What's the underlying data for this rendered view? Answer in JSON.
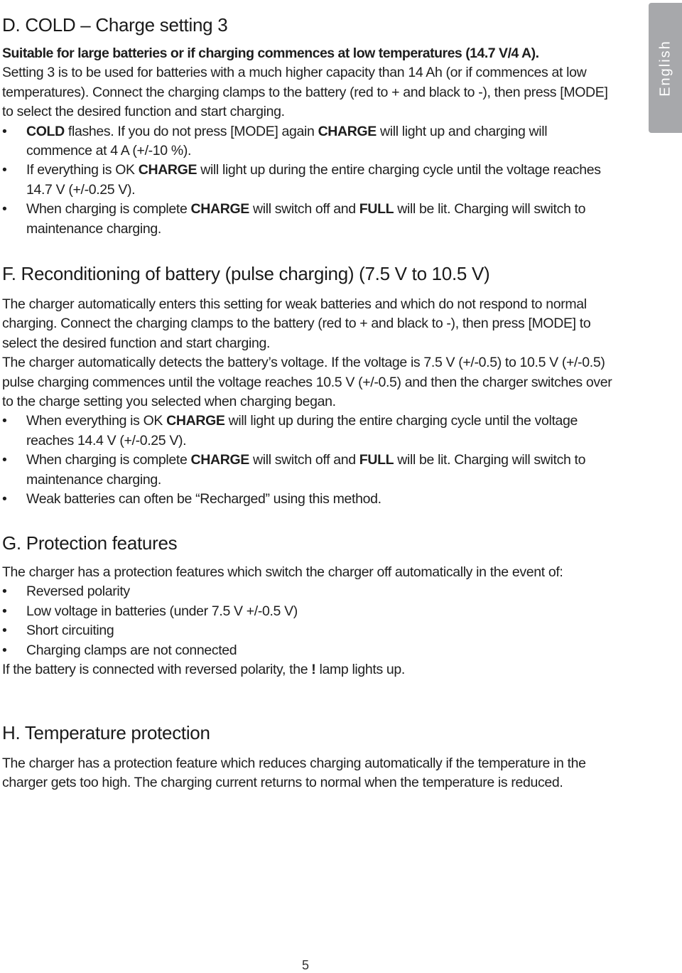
{
  "side_tab": {
    "label": "English",
    "color": "#a7a8ab"
  },
  "sections": {
    "d": {
      "heading": "D. COLD – Charge setting 3",
      "lead": "Suitable for large batteries or if charging commences at low temperatures (14.7 V/4 A).",
      "intro": "Setting 3 is to be used for batteries with a much higher capacity than 14 Ah (or if commences at low temperatures). Connect the charging clamps to the battery (red to + and black to -), then press [MODE] to select the desired function and start charging.",
      "bullets": [
        {
          "b1": "COLD",
          "t1": " flashes. If you do not press [MODE] again ",
          "b2": "CHARGE",
          "t2": " will light up and charging will commence at 4 A (+/-10 %)."
        },
        {
          "t0": "If everything is OK ",
          "b1": "CHARGE",
          "t1": " will light up during the entire charging cycle until the voltage reaches 14.7 V (+/-0.25 V)."
        },
        {
          "t0": "When charging is complete ",
          "b1": "CHARGE",
          "t1": " will switch off and ",
          "b2": "FULL",
          "t2": " will be lit. Charging will switch to maintenance charging."
        }
      ]
    },
    "f": {
      "heading": "F. Reconditioning of battery (pulse charging) (7.5 V to 10.5 V)",
      "intro": "The charger automatically enters this setting for weak batteries and which do not respond to normal charging. Connect the charging clamps to the battery (red to + and black to -), then press [MODE] to select the desired function and start charging.",
      "intro2": "The charger automatically detects the battery’s voltage. If the voltage is 7.5 V (+/-0.5) to 10.5 V (+/-0.5) pulse charging commences until the voltage reaches 10.5 V (+/-0.5) and then the charger switches over to the charge setting you selected when charging began.",
      "bullets": [
        {
          "t0": "When everything is OK ",
          "b1": "CHARGE",
          "t1": " will light up during the entire charging cycle until the voltage reaches 14.4 V (+/-0.25 V)."
        },
        {
          "t0": "When charging is complete ",
          "b1": "CHARGE",
          "t1": " will switch off and ",
          "b2": "FULL",
          "t2": " will be lit. Charging will switch to maintenance charging."
        },
        {
          "t0": "Weak batteries can often be “Recharged” using this method."
        }
      ]
    },
    "g": {
      "heading": "G. Protection features",
      "intro": "The charger has a protection features which switch the charger off automatically in the event of:",
      "bullets": [
        "Reversed polarity",
        "Low voltage in batteries (under 7.5 V +/-0.5 V)",
        "Short circuiting",
        "Charging clamps are not connected"
      ],
      "outro_pre": "If the battery is connected with reversed polarity, the ",
      "outro_bold": "!",
      "outro_post": " lamp lights up."
    },
    "h": {
      "heading": "H. Temperature protection",
      "body": "The charger has a protection feature which reduces charging automatically if the temperature in the charger gets too high. The charging current returns to normal when the temperature is reduced."
    }
  },
  "page_number": "5",
  "bullet_glyph": "•"
}
